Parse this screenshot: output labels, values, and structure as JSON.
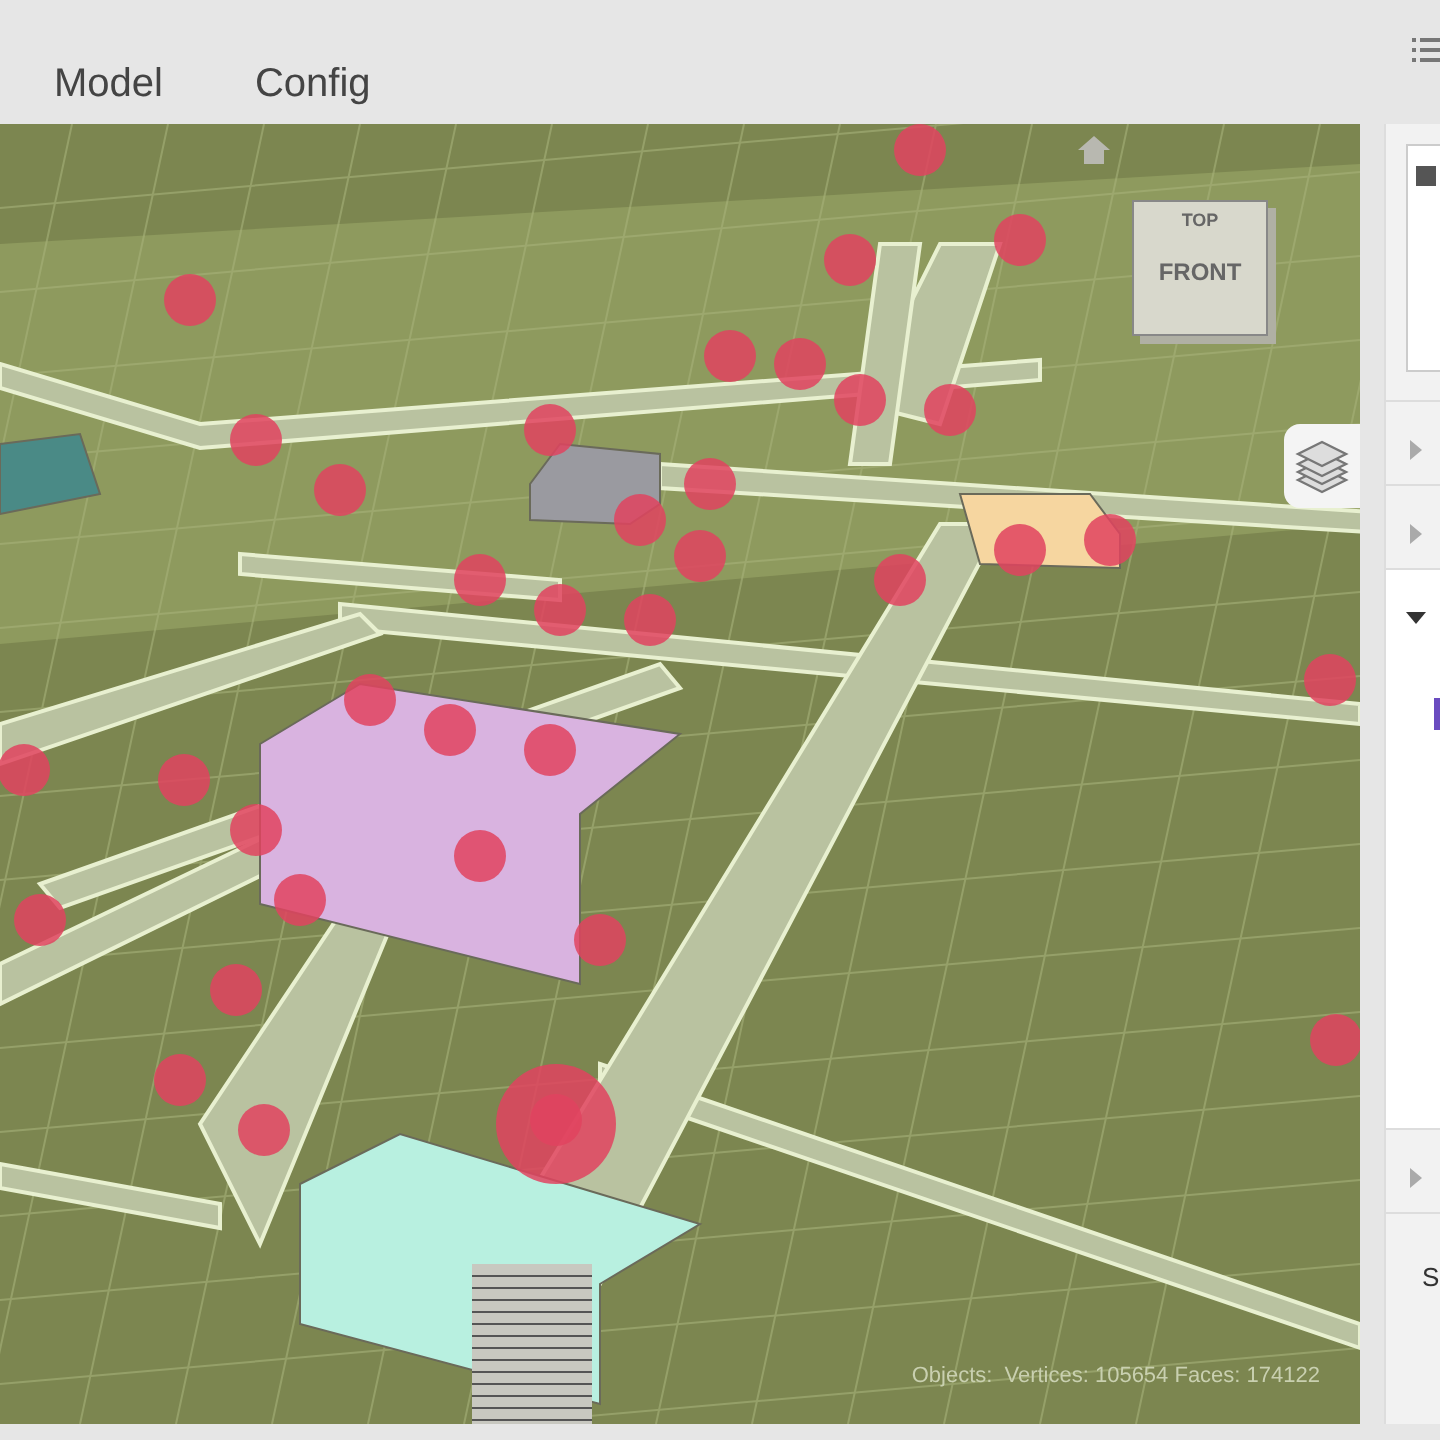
{
  "tabs": [
    {
      "label": "Model"
    },
    {
      "label": "Config"
    }
  ],
  "viewport": {
    "view_cube": {
      "top": "TOP",
      "front": "FRONT"
    },
    "stats": {
      "objects": "Objects:",
      "counts": "Vertices: 105654 Faces: 174122"
    }
  },
  "panel": {
    "sections": [
      {
        "expanded": false
      },
      {
        "expanded": false
      },
      {
        "expanded": true
      },
      {
        "expanded": false
      }
    ],
    "footer": "S"
  }
}
